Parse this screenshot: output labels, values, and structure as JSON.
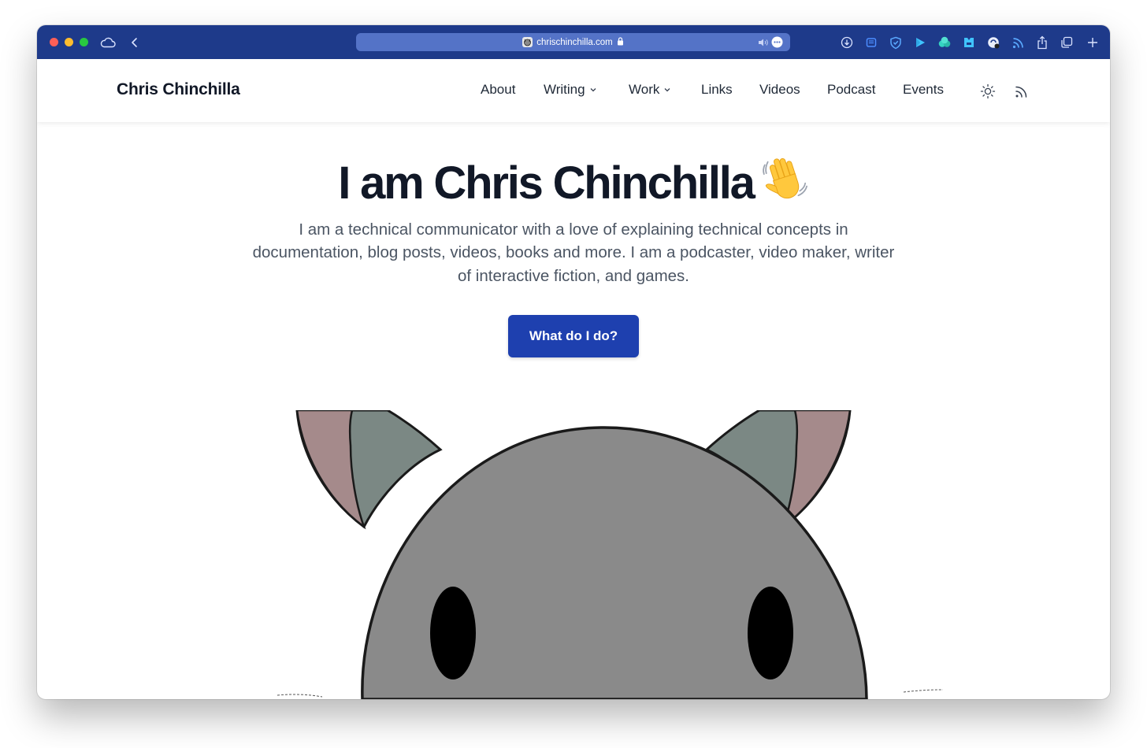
{
  "browser": {
    "url": "chrischinchilla.com",
    "theme_color": "#1e3a8a",
    "icons": [
      "icloud-icon",
      "back-icon",
      "lock-icon",
      "audio-icon",
      "more-icon",
      "download-icon",
      "extension-icon",
      "shield-icon",
      "play-icon",
      "extension-icon",
      "extension-icon",
      "extension-icon",
      "rss-icon",
      "share-icon",
      "tabs-icon",
      "new-tab-icon"
    ]
  },
  "site": {
    "brand": "Chris Chinchilla",
    "nav": {
      "about": "About",
      "writing": "Writing",
      "work": "Work",
      "links": "Links",
      "videos": "Videos",
      "podcast": "Podcast",
      "events": "Events"
    }
  },
  "hero": {
    "title": "I am Chris Chinchilla",
    "subtitle": "I am a technical communicator with a love of explaining technical concepts in documentation, blog posts, videos, books and more. I am a podcaster, video maker, writer of interactive fiction, and games.",
    "cta_label": "What do I do?",
    "accent_color": "#1e40af"
  }
}
